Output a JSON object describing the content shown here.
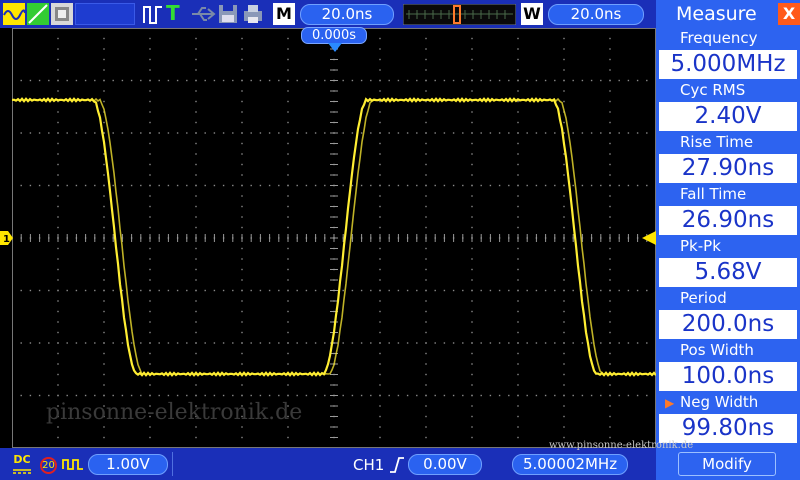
{
  "top_bar": {
    "mode_m": "M",
    "timebase": "20.0ns",
    "trigger_offset": "0.000s",
    "mode_w": "W",
    "window_timebase": "20.0ns",
    "run_state_letter": "T"
  },
  "measure_panel": {
    "title": "Measure",
    "close_label": "X",
    "items": [
      {
        "label": "Frequency",
        "value": "5.000MHz"
      },
      {
        "label": "Cyc RMS",
        "value": "2.40V"
      },
      {
        "label": "Rise Time",
        "value": "27.90ns"
      },
      {
        "label": "Fall Time",
        "value": "26.90ns"
      },
      {
        "label": "Pk-Pk",
        "value": "5.68V"
      },
      {
        "label": "Period",
        "value": "200.0ns"
      },
      {
        "label": "Pos Width",
        "value": "100.0ns"
      },
      {
        "label": "Neg Width",
        "value": "99.80ns"
      }
    ],
    "selected_index": 7,
    "modify_label": "Modify"
  },
  "bottom_bar": {
    "coupling": "DC",
    "bandwidth_limit": "20",
    "ch1_scale": "1.00V",
    "trigger_source": "CH1",
    "trigger_level": "0.00V",
    "counter_freq": "5.00002MHz"
  },
  "screen": {
    "channel_marker": "1",
    "watermark": "pinsonne-elektronik.de",
    "url": "www.pinsonne-elektronik.de",
    "trace_color": "#ffee33"
  }
}
